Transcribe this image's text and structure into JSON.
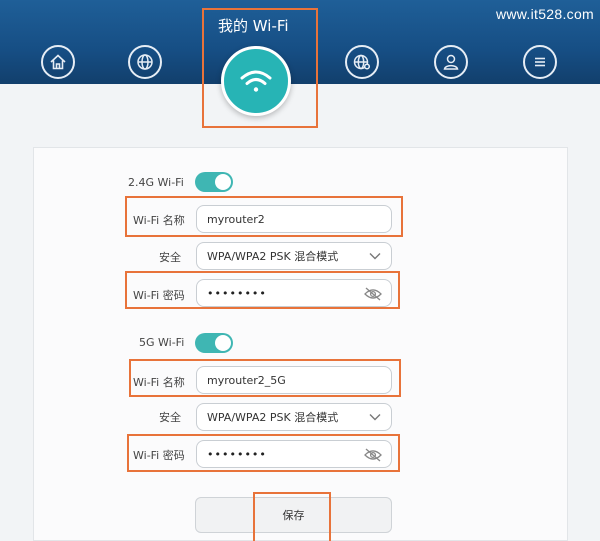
{
  "watermark": "www.it528.com",
  "header": {
    "title": "我的 Wi-Fi",
    "nav_icons": [
      "home-icon",
      "globe-icon",
      "wifi-icon",
      "globe-gear-icon",
      "user-icon",
      "menu-icon"
    ]
  },
  "band24": {
    "label": "2.4G Wi-Fi",
    "enabled": true,
    "name_label": "Wi-Fi 名称",
    "name_value": "myrouter2",
    "security_label": "安全",
    "security_value": "WPA/WPA2 PSK 混合模式",
    "password_label": "Wi-Fi 密码",
    "password_masked": "••••••••"
  },
  "band5": {
    "label": "5G Wi-Fi",
    "enabled": true,
    "name_label": "Wi-Fi 名称",
    "name_value": "myrouter2_5G",
    "security_label": "安全",
    "security_value": "WPA/WPA2 PSK 混合模式",
    "password_label": "Wi-Fi 密码",
    "password_masked": "••••••••"
  },
  "save_label": "保存",
  "colors": {
    "header": "#1a5a93",
    "accent": "#27b4b5",
    "toggle": "#3fb6b3",
    "highlight": "#e8733a"
  }
}
